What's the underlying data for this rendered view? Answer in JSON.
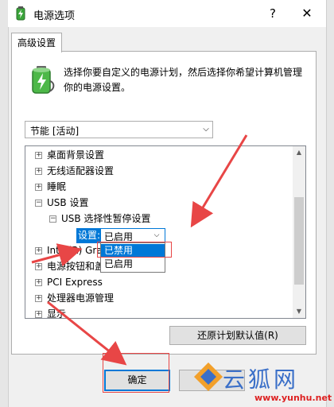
{
  "window": {
    "title": "电源选项",
    "help_glyph": "?",
    "close_glyph": "✕"
  },
  "tab": {
    "label": "高级设置"
  },
  "description": "选择你要自定义的电源计划，然后选择你希望计算机管理你的电源设置。",
  "plan_select": {
    "value": "节能 [活动]",
    "arrow": "⌵"
  },
  "tree": {
    "items": [
      {
        "expander": "+",
        "label": "桌面背景设置"
      },
      {
        "expander": "+",
        "label": "无线适配器设置"
      },
      {
        "expander": "+",
        "label": "睡眠"
      },
      {
        "expander": "−",
        "label": "USB 设置"
      },
      {
        "expander": "−",
        "label": "USB 选择性暂停设置"
      },
      {
        "expander": "+",
        "label": "Intel(R) Gra"
      },
      {
        "expander": "+",
        "label": "电源按钮和盖"
      },
      {
        "expander": "+",
        "label": "PCI Express"
      },
      {
        "expander": "+",
        "label": "处理器电源管理"
      },
      {
        "expander": "+",
        "label": "显示"
      }
    ],
    "setting_label": "设置:",
    "setting_value": "已启用",
    "setting_arrow": "⌵",
    "dropdown_options": [
      "已禁用",
      "已启用"
    ]
  },
  "scrollbar": {
    "up_glyph": "▲",
    "down_glyph": "▼"
  },
  "buttons": {
    "restore": "还原计划默认值(R)",
    "ok": "确定",
    "cancel": ""
  },
  "watermark": {
    "text": "云狐网",
    "url": "www.yunhu.net"
  },
  "colors": {
    "accent": "#0078d7",
    "annotation_red": "#e84646",
    "window_bg": "#f0f0f0"
  }
}
